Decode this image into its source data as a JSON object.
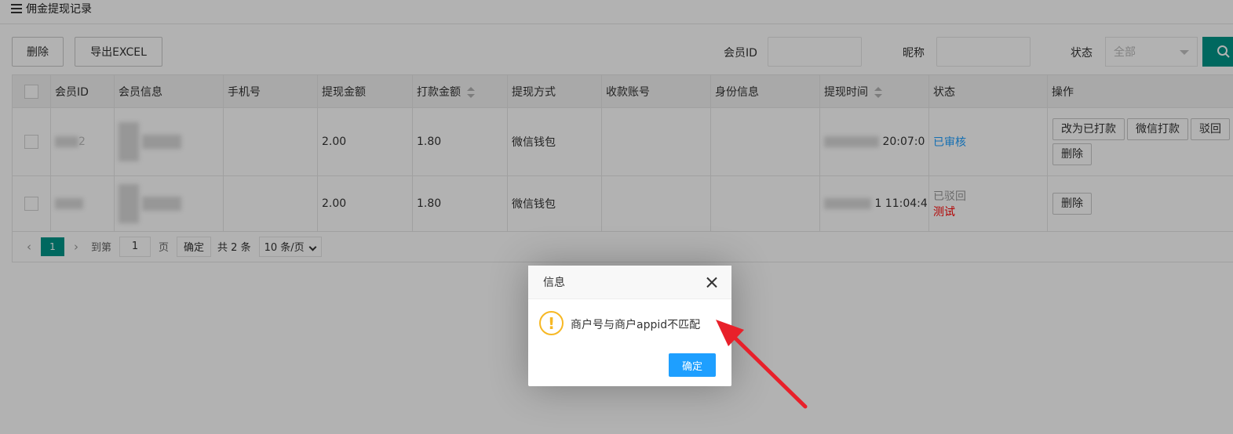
{
  "panel": {
    "title": "佣金提现记录"
  },
  "toolbar": {
    "delete_label": "删除",
    "export_label": "导出EXCEL"
  },
  "filters": {
    "member_id_label": "会员ID",
    "member_id_value": "",
    "nickname_label": "昵称",
    "nickname_value": "",
    "status_label": "状态",
    "status_selected": "全部"
  },
  "table": {
    "headers": [
      "会员ID",
      "会员信息",
      "手机号",
      "提现金额",
      "打款金额",
      "提现方式",
      "收款账号",
      "身份信息",
      "提现时间",
      "状态",
      "操作"
    ],
    "rows": [
      {
        "member_id": "2",
        "member_info": "",
        "phone": "",
        "withdraw_amount": "2.00",
        "paid_amount": "1.80",
        "method": "微信钱包",
        "account": "",
        "identity": "",
        "time": "20:07:0",
        "status": "已审核",
        "status_note": "",
        "actions": [
          "改为已打款",
          "微信打款",
          "驳回",
          "删除"
        ]
      },
      {
        "member_id": "",
        "member_info": "",
        "phone": "",
        "withdraw_amount": "2.00",
        "paid_amount": "1.80",
        "method": "微信钱包",
        "account": "",
        "identity": "",
        "time": "1 11:04:4",
        "status": "已驳回",
        "status_note": "测试",
        "actions": [
          "删除"
        ]
      }
    ]
  },
  "pager": {
    "current_page": "1",
    "goto_label": "到第",
    "goto_value": "1",
    "page_unit": "页",
    "confirm_label": "确定",
    "total_label": "共 2 条",
    "page_size": "10 条/页"
  },
  "dialog": {
    "title": "信息",
    "message": "商户号与商户appid不匹配",
    "ok_label": "确定"
  },
  "colors": {
    "primary_green": "#009688",
    "primary_blue": "#1e9fff",
    "warning": "#f7b824",
    "annotation_arrow": "#e8202a"
  },
  "icons": [
    "list-icon",
    "search-icon",
    "checkbox-icon",
    "sort-icon",
    "chevron-left-icon",
    "chevron-right-icon",
    "chevron-down-icon",
    "close-icon",
    "warning-icon",
    "annotation-arrow"
  ]
}
